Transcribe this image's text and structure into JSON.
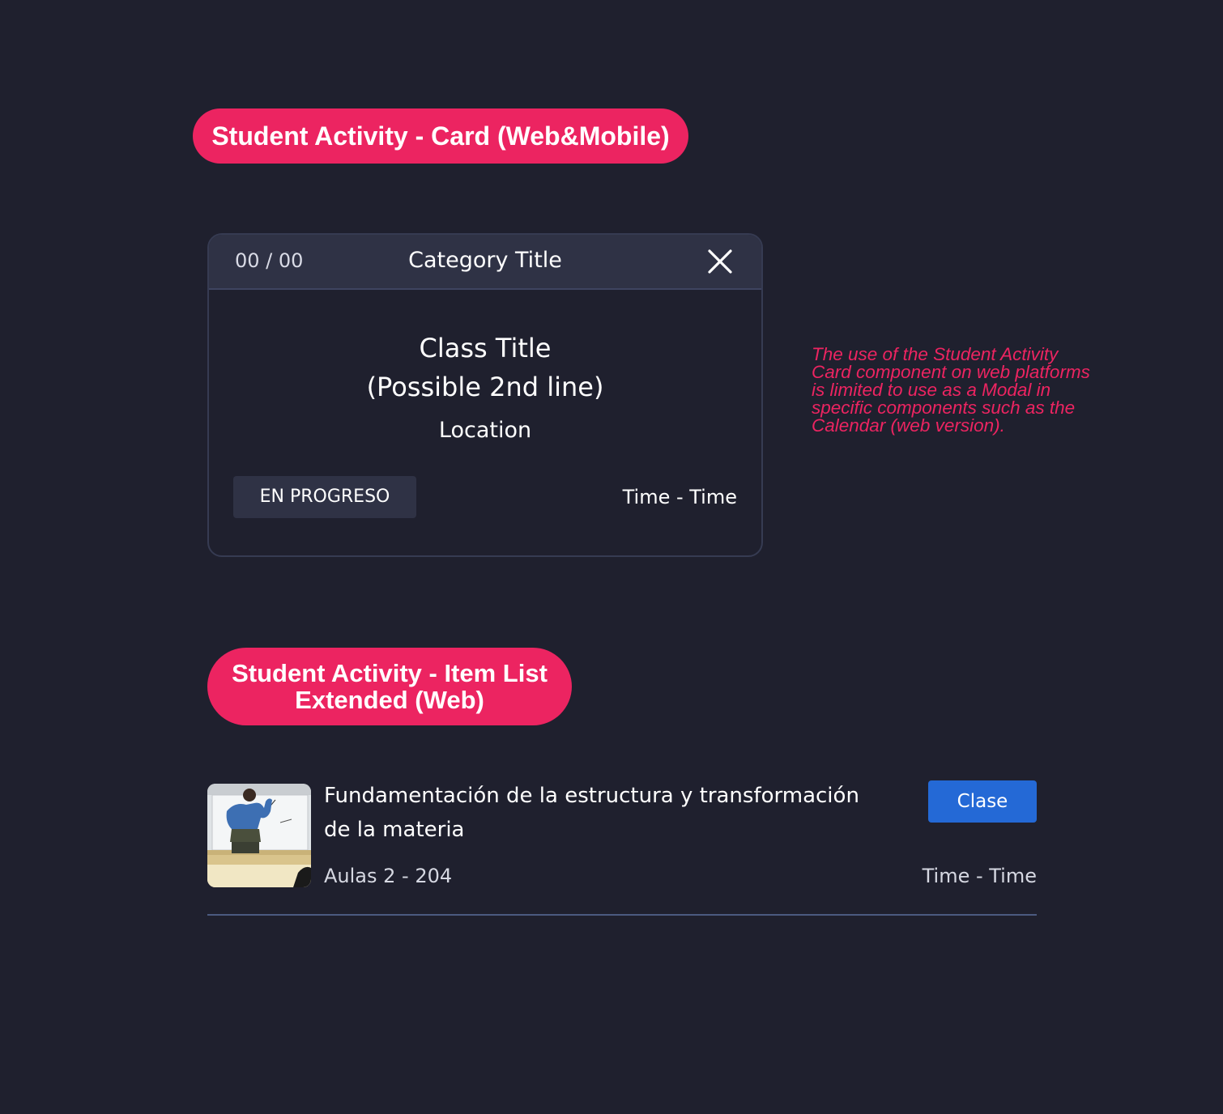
{
  "sections": {
    "card_label": "Student Activity - Card (Web&Mobile)",
    "list_label_line1": "Student Activity - Item List",
    "list_label_line2": "Extended (Web)"
  },
  "card": {
    "counter": "00 / 00",
    "category_title": "Category Title",
    "close_icon": "close-icon",
    "class_title_line1": "Class Title",
    "class_title_line2": "(Possible 2nd line)",
    "location": "Location",
    "status": "EN PROGRESO",
    "time": "Time - Time"
  },
  "note": {
    "line1": "The use of the Student Activity",
    "line2": "Card component on web platforms",
    "line3": "is limited to use as a Modal in",
    "line4": "specific components such as the",
    "line5": "Calendar (web version)."
  },
  "list_item": {
    "thumbnail_icon": "classroom-photo",
    "title_line1": "Fundamentación de la estructura y transformación",
    "title_line2": "de la materia",
    "tag": "Clase",
    "location": "Aulas 2 - 204",
    "time": "Time - Time"
  },
  "colors": {
    "background": "#1f202e",
    "accent": "#ec2461",
    "header": "#2f3245",
    "button": "#2469d6"
  }
}
